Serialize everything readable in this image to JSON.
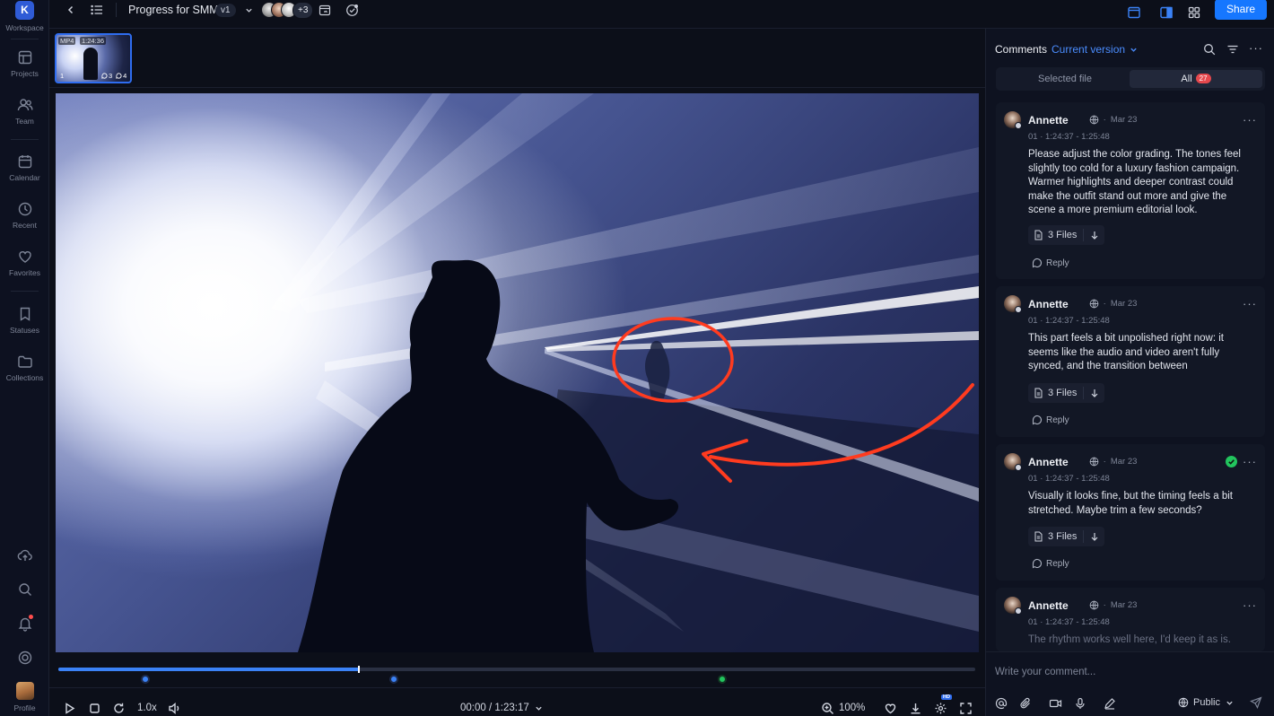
{
  "rail": {
    "workspace_initial": "K",
    "items": [
      {
        "label": "Workspace",
        "icon": "workspace-logo"
      },
      {
        "label": "Projects",
        "icon": "projects-icon"
      },
      {
        "label": "Team",
        "icon": "team-icon"
      },
      {
        "label": "Calendar",
        "icon": "calendar-icon"
      },
      {
        "label": "Recent",
        "icon": "recent-icon"
      },
      {
        "label": "Favorites",
        "icon": "heart-icon"
      },
      {
        "label": "Statuses",
        "icon": "bookmark-icon"
      },
      {
        "label": "Collections",
        "icon": "folder-icon"
      },
      {
        "label": "Profile",
        "icon": "profile-avatar"
      }
    ]
  },
  "topbar": {
    "title": "Progress for SMM",
    "version": "v1",
    "extra_avatars": "+3",
    "share_label": "Share"
  },
  "thumbnail": {
    "format": "MP4",
    "duration": "1:24:36",
    "index": "1",
    "comment_count": "3",
    "reply_count": "4"
  },
  "player": {
    "timecode": "00:00 / 1:23:17",
    "speed": "1.0x",
    "zoom": "100%",
    "quality_badge": "HD",
    "progress": 0.328
  },
  "comments_panel": {
    "title": "Comments",
    "version_filter": "Current version",
    "tabs": [
      {
        "label": "Selected file",
        "active": false
      },
      {
        "label": "All",
        "active": true,
        "count": "27"
      }
    ],
    "comments": [
      {
        "author": "Annette",
        "date": "Mar 23",
        "timecode": "01 · 1:24:37 - 1:25:48",
        "text": "Please adjust the color grading. The tones feel slightly too cold for a luxury fashion campaign. Warmer highlights and deeper contrast could make the outfit stand out more and give the scene a more premium editorial look.",
        "files": "3 Files",
        "reply": "Reply",
        "resolved": false
      },
      {
        "author": "Annette",
        "date": "Mar 23",
        "timecode": "01 · 1:24:37 - 1:25:48",
        "text": "This part feels a bit unpolished right now: it seems like the audio and video aren't fully synced, and the transition between",
        "files": "3 Files",
        "reply": "Reply",
        "resolved": false
      },
      {
        "author": "Annette",
        "date": "Mar 23",
        "timecode": "01 · 1:24:37 - 1:25:48",
        "text": "Visually it looks fine, but the timing feels a bit stretched. Maybe trim a few seconds?",
        "files": "3 Files",
        "reply": "Reply",
        "resolved": true
      },
      {
        "author": "Annette",
        "date": "Mar 23",
        "timecode": "01 · 1:24:37 - 1:25:48",
        "text": "The rhythm works well here, I'd keep it as is."
      }
    ],
    "composer_placeholder": "Write your comment...",
    "visibility": "Public"
  },
  "colors": {
    "accent": "#1677ff",
    "annotation": "#ff3b1f",
    "resolved": "#22c55e",
    "badge": "#e5484d"
  }
}
